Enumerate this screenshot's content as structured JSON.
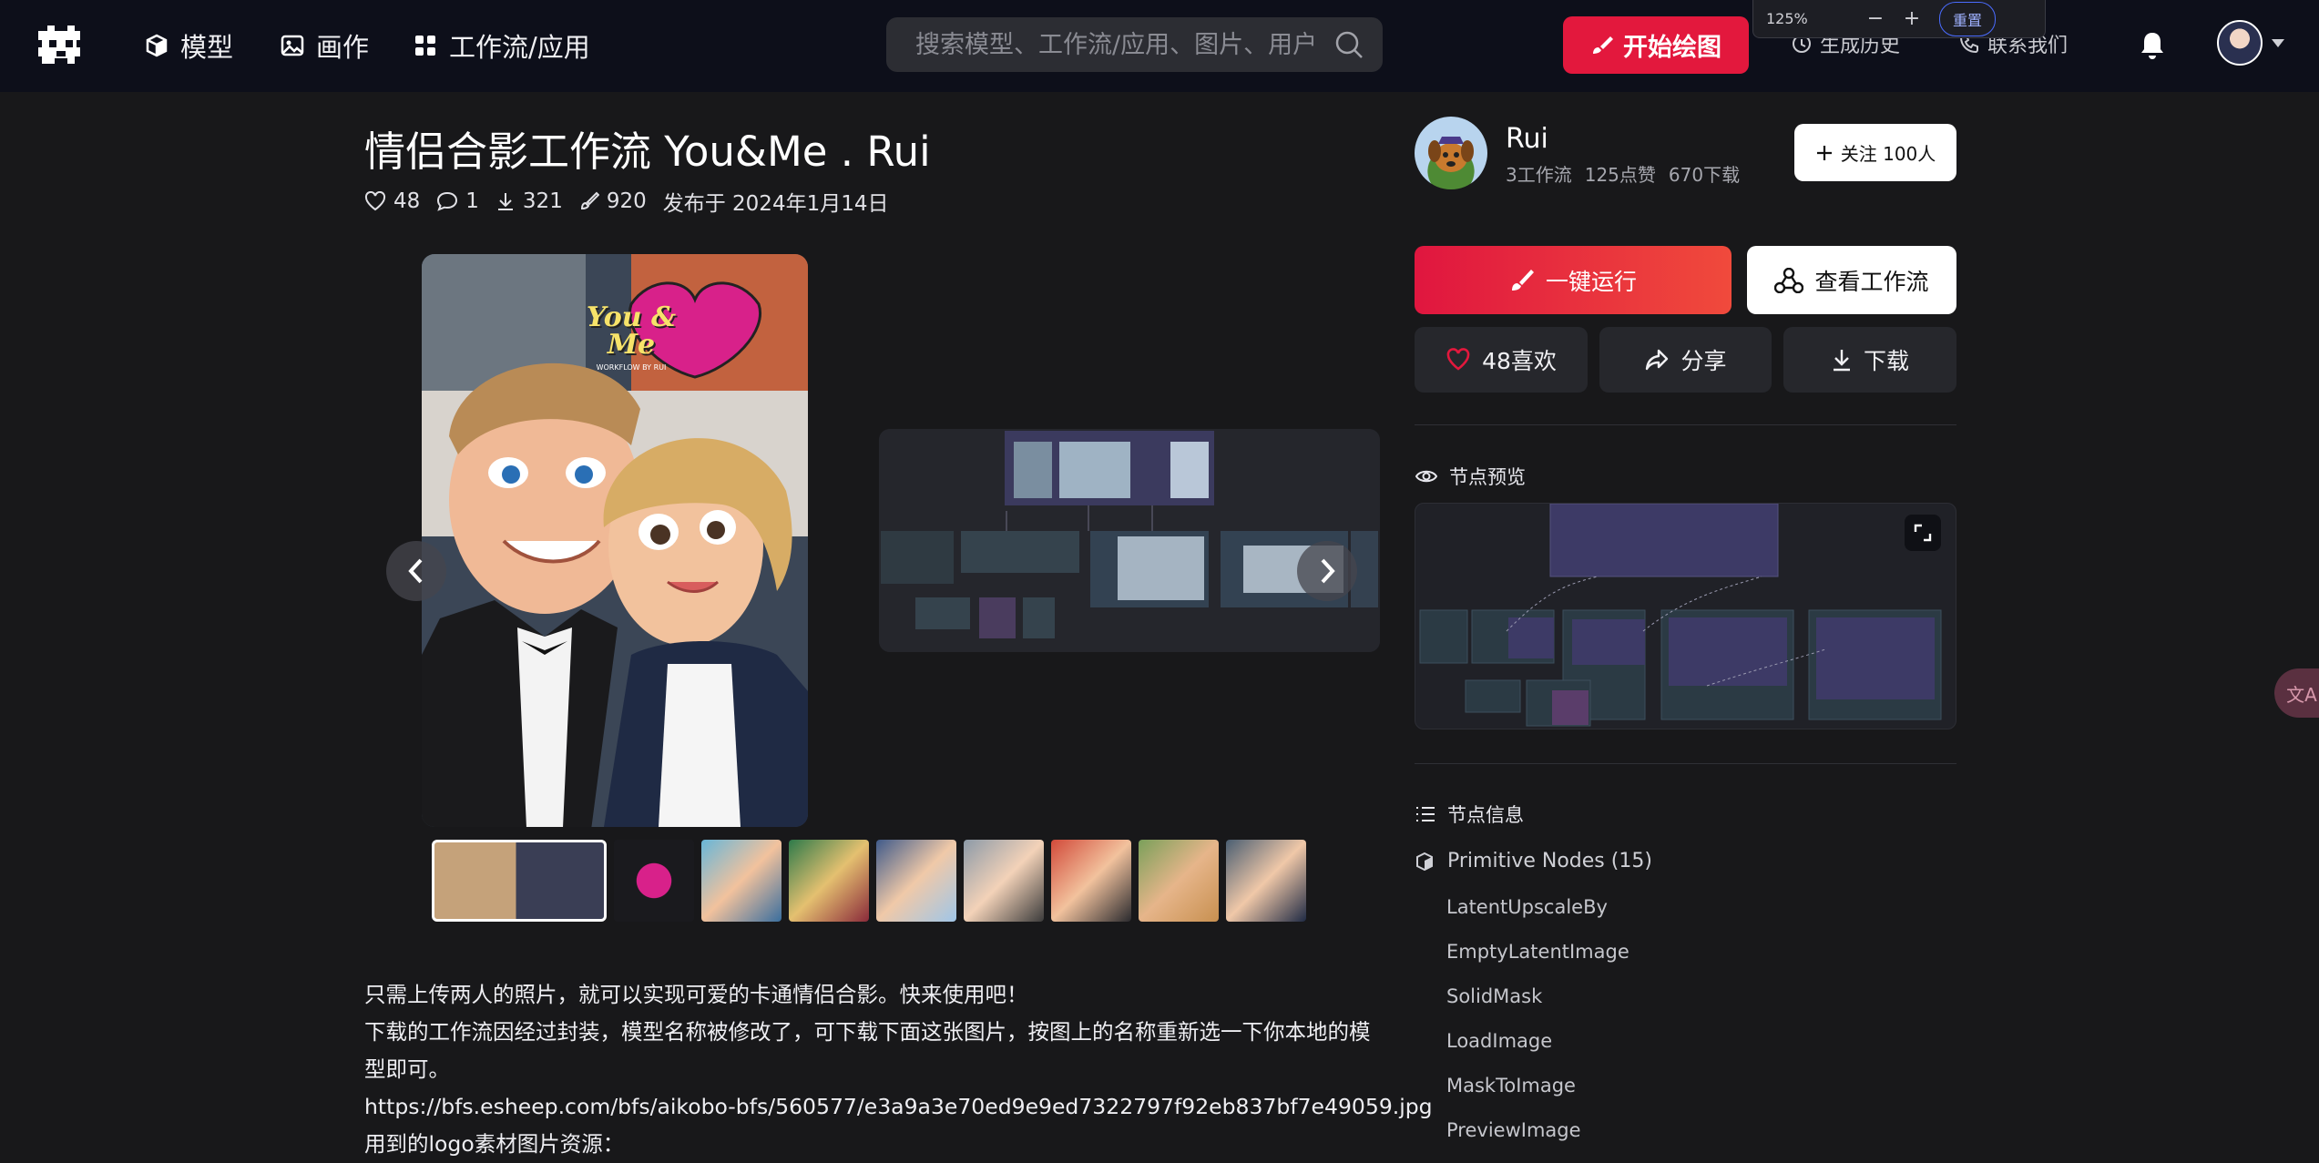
{
  "nav": {
    "items": [
      {
        "label": "模型",
        "icon": "cube-icon"
      },
      {
        "label": "画作",
        "icon": "image-icon"
      },
      {
        "label": "工作流/应用",
        "icon": "grid-icon"
      }
    ],
    "search_placeholder": "搜索模型、工作流/应用、图片、用户",
    "draw_button": "开始绘图",
    "history_link": "生成历史",
    "contact_link": "联系我们"
  },
  "zoom": {
    "level": "125%",
    "minus": "−",
    "plus": "+",
    "reset": "重置"
  },
  "workflow": {
    "title": "情侣合影工作流 You&Me . Rui",
    "likes": "48",
    "comments": "1",
    "downloads": "321",
    "runs": "920",
    "published": "发布于 2024年1月14日",
    "logo_text": "You & Me",
    "logo_sub": "WORKFLOW BY RUI"
  },
  "thumbnails": [
    {
      "name": "workflow-overview"
    },
    {
      "name": "you-me-logo"
    },
    {
      "name": "couple-1"
    },
    {
      "name": "couple-2"
    },
    {
      "name": "couple-3"
    },
    {
      "name": "couple-4"
    },
    {
      "name": "couple-5"
    },
    {
      "name": "couple-6"
    },
    {
      "name": "couple-7"
    }
  ],
  "description": {
    "line1": "只需上传两人的照片，就可以实现可爱的卡通情侣合影。快来使用吧！",
    "line2": "下载的工作流因经过封装，模型名称被修改了，可下载下面这张图片，按图上的名称重新选一下你本地的模型即可。",
    "line3": "https://bfs.esheep.com/bfs/aikobo-bfs/560577/e3a9a3e70ed9e9ed7322797f92eb837bf7e49059.jpg",
    "line4": "用到的logo素材图片资源："
  },
  "author": {
    "name": "Rui",
    "workflows": "3工作流",
    "likes": "125点赞",
    "downloads": "670下载",
    "follow_label": "关注 100人"
  },
  "actions": {
    "run": "一键运行",
    "view": "查看工作流",
    "like": "48喜欢",
    "share": "分享",
    "download": "下载"
  },
  "node_preview": {
    "title": "节点预览"
  },
  "node_info": {
    "title": "节点信息",
    "category": "Primitive Nodes (15)",
    "nodes": [
      "LatentUpscaleBy",
      "EmptyLatentImage",
      "SolidMask",
      "LoadImage",
      "MaskToImage",
      "PreviewImage"
    ]
  },
  "translate_fab": "文A",
  "colors": {
    "accent": "#e3183d",
    "background": "#18181a",
    "topbar": "#0d0f1a",
    "panel": "#26272c"
  }
}
